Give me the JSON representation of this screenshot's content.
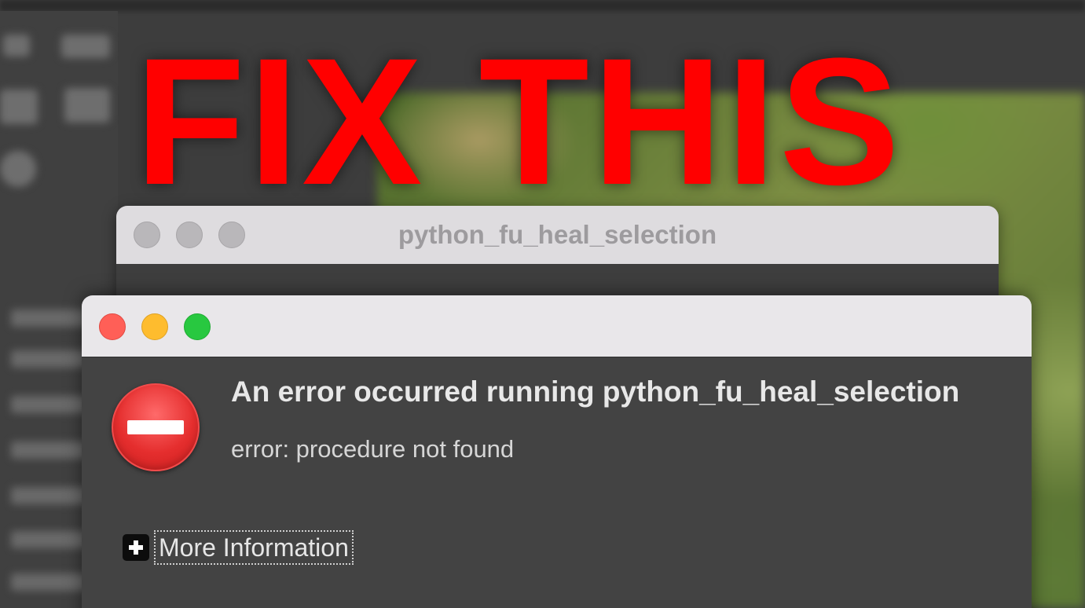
{
  "overlay": {
    "headline": "FIX THIS",
    "color": "#ff0000"
  },
  "background_window": {
    "title": "python_fu_heal_selection",
    "traffic_lights": [
      "close-inactive",
      "minimize-inactive",
      "zoom-inactive"
    ]
  },
  "error_dialog": {
    "traffic_lights": {
      "close_color": "#ff5f57",
      "minimize_color": "#febc2e",
      "zoom_color": "#28c840"
    },
    "icon": "error-stop-icon",
    "heading": "An error occurred running python_fu_heal_selection",
    "detail": "error: procedure not found",
    "more_info": {
      "icon": "plus-expander-icon",
      "label": "More Information",
      "expanded": false
    }
  }
}
